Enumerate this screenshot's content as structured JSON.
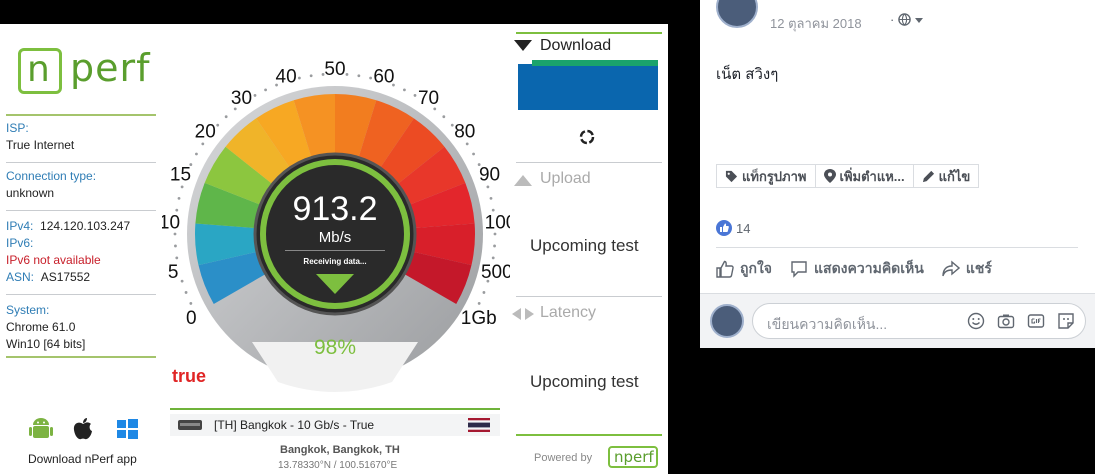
{
  "nperf": {
    "logo": "nperf",
    "isp_label": "ISP:",
    "isp_value": "True Internet",
    "conn_label": "Connection type:",
    "conn_value": "unknown",
    "ipv4_label": "IPv4:",
    "ipv4_value": "124.120.103.247",
    "ipv6_label": "IPv6:",
    "ipv6_value": "IPv6 not available",
    "asn_label": "ASN:",
    "asn_value": "AS17552",
    "system_label": "System:",
    "system_browser": "Chrome 61.0",
    "system_os": "Win10 [64 bits]",
    "app_label": "Download nPerf app",
    "gauge": {
      "speed": "913.2",
      "unit": "Mb/s",
      "status": "Receiving data...",
      "progress": "98%",
      "ticks": [
        "0",
        "5",
        "10",
        "15",
        "20",
        "30",
        "40",
        "50",
        "60",
        "70",
        "80",
        "90",
        "100",
        "500",
        "1Gb"
      ]
    },
    "isp_logo": "true",
    "server": "[TH] Bangkok - 10 Gb/s - True",
    "location": "Bangkok, Bangkok, TH",
    "coords": "13.78330°N / 100.51670°E",
    "download_label": "Download",
    "upload_label": "Upload",
    "upload_status": "Upcoming test",
    "latency_label": "Latency",
    "latency_status": "Upcoming test",
    "powered_by": "Powered by"
  },
  "post": {
    "date": "12 ตุลาคม 2018",
    "privacy_sep": "·",
    "text": "เน็ต สวิงๆ",
    "tags": [
      {
        "label": "แท็กรูปภาพ"
      },
      {
        "label": "เพิ่มตำแห..."
      },
      {
        "label": "แก้ไข"
      }
    ],
    "like_count": "14",
    "actions": {
      "like": "ถูกใจ",
      "comment": "แสดงความคิดเห็น",
      "share": "แชร์"
    },
    "comment_placeholder": "เขียนความคิดเห็น..."
  },
  "colors": {
    "green": "#6fb33a",
    "blue_bar": "#0a66ae",
    "fb_link": "#365899"
  }
}
